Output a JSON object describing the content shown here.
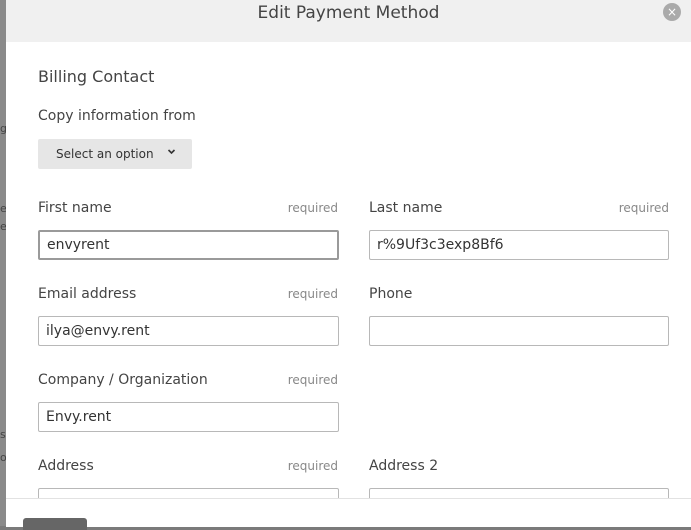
{
  "modal": {
    "title": "Edit Payment Method",
    "close_icon": "×"
  },
  "billing": {
    "heading": "Billing Contact",
    "copy_label": "Copy information from",
    "copy_select": "Select an option"
  },
  "required_text": "required",
  "fields": {
    "first_name": {
      "label": "First name",
      "value": "envyrent",
      "required": true
    },
    "last_name": {
      "label": "Last name",
      "value": "r%9Uf3c3exp8Bf6",
      "required": true
    },
    "email": {
      "label": "Email address",
      "value": "ilya@envy.rent",
      "required": true
    },
    "phone": {
      "label": "Phone",
      "value": "",
      "required": false
    },
    "company": {
      "label": "Company / Organization",
      "value": "Envy.rent",
      "required": true
    },
    "address": {
      "label": "Address",
      "value": "",
      "required": true
    },
    "address2": {
      "label": "Address 2",
      "value": "",
      "required": false
    }
  },
  "backdrop": {
    "fragments": [
      "g",
      "e",
      "e",
      "s",
      "o"
    ]
  },
  "icons": {
    "close": "close-icon",
    "dropdown": "chevron-down-icon"
  }
}
